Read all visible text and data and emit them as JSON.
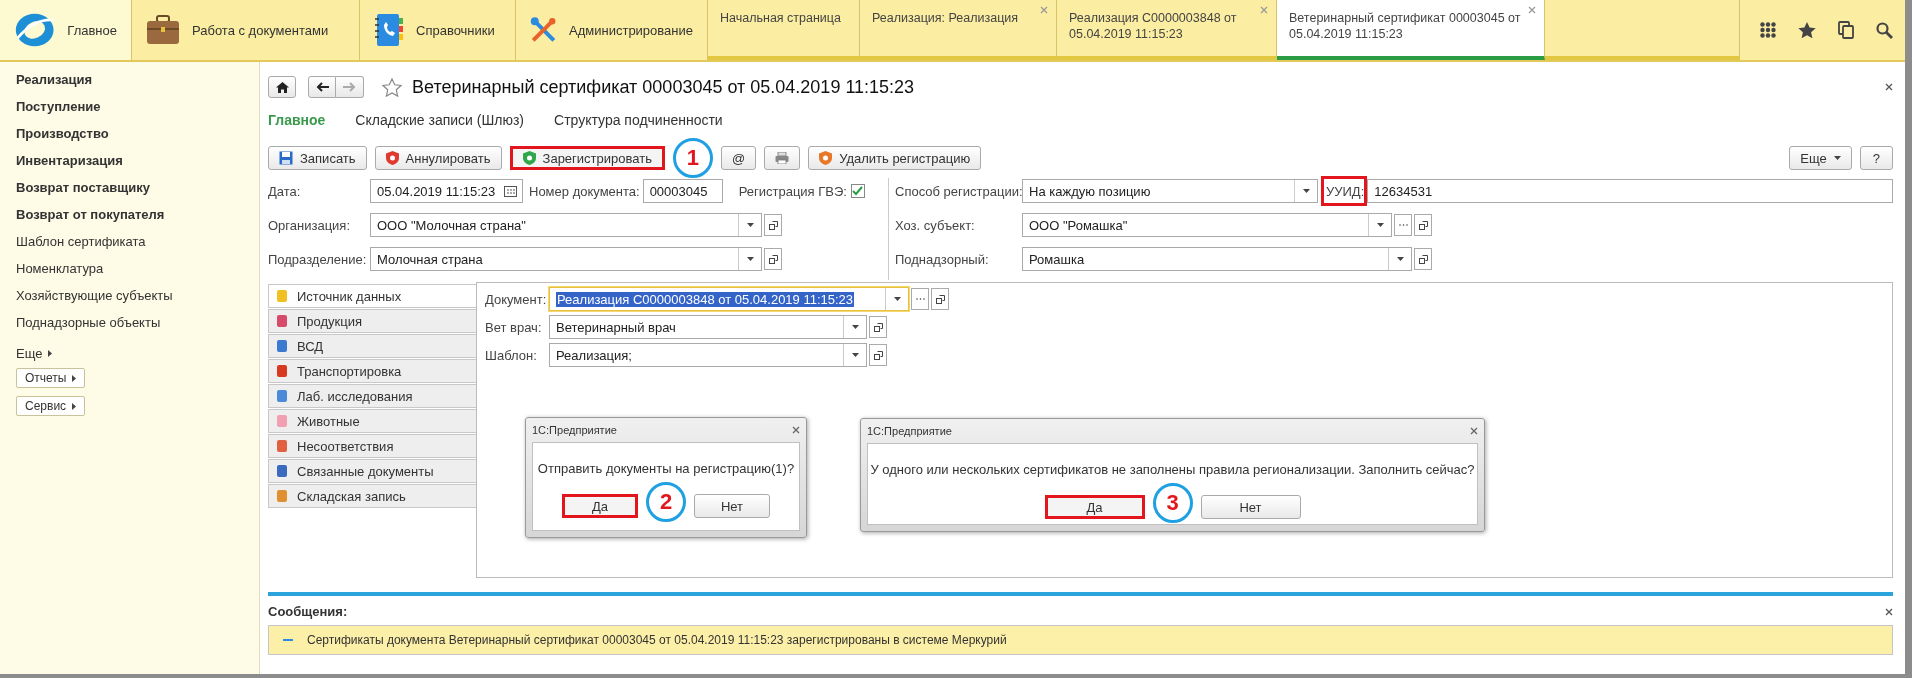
{
  "top_sections": [
    {
      "label": "Главное",
      "selected": true
    },
    {
      "label": "Работа с документами",
      "selected": false
    },
    {
      "label": "Справочники",
      "selected": false
    },
    {
      "label": "Администрирование",
      "selected": false
    }
  ],
  "open_tabs": [
    {
      "label": "Начальная страница",
      "selected": false,
      "closable": false
    },
    {
      "label": "Реализация: Реализация",
      "selected": false,
      "closable": true
    },
    {
      "label": "Реализация С0000003848 от 05.04.2019 11:15:23",
      "selected": false,
      "closable": true
    },
    {
      "label": "Ветеринарный сертификат 00003045 от 05.04.2019 11:15:23",
      "selected": true,
      "closable": true
    }
  ],
  "sidebar": {
    "items": [
      {
        "label": "Реализация",
        "bold": true
      },
      {
        "label": "Поступление",
        "bold": true
      },
      {
        "label": "Производство",
        "bold": true
      },
      {
        "label": "Инвентаризация",
        "bold": true
      },
      {
        "label": "Возврат поставщику",
        "bold": true
      },
      {
        "label": "Возврат от покупателя",
        "bold": true
      },
      {
        "label": "Шаблон сертификата",
        "bold": false
      },
      {
        "label": "Номенклатура",
        "bold": false
      },
      {
        "label": "Хозяйствующие субъекты",
        "bold": false
      },
      {
        "label": "Поднадзорные объекты",
        "bold": false
      }
    ],
    "more": "Еще",
    "buttons": [
      "Отчеты",
      "Сервис"
    ]
  },
  "form": {
    "title": "Ветеринарный сертификат 00003045 от 05.04.2019 11:15:23",
    "nav": [
      {
        "label": "Главное",
        "selected": true
      },
      {
        "label": "Складские записи (Шлюз)",
        "selected": false
      },
      {
        "label": "Структура подчиненности",
        "selected": false
      }
    ],
    "toolbar": [
      {
        "kind": "save",
        "label": "Записать",
        "highlighted": false
      },
      {
        "kind": "cancel",
        "label": "Аннулировать",
        "highlighted": false
      },
      {
        "kind": "register",
        "label": "Зарегистрировать",
        "highlighted": true
      },
      {
        "kind": "mail",
        "label": "@",
        "highlighted": false
      },
      {
        "kind": "print",
        "highlighted": false
      },
      {
        "kind": "unregister",
        "label": "Удалить регистрацию",
        "highlighted": false
      }
    ],
    "toolbar_right": [
      {
        "kind": "menu",
        "label": "Еще"
      },
      {
        "kind": "help",
        "label": "?"
      }
    ],
    "date": {
      "label": "Дата:",
      "value": "05.04.2019 11:15:23"
    },
    "number": {
      "label": "Номер документа:",
      "value": "00003045"
    },
    "vet_registration": {
      "label": "Регистрация ГВЭ:",
      "checked": true
    },
    "method": {
      "label": "Способ регистрации:",
      "value": "На каждую позицию"
    },
    "uuid": {
      "label": "УУИД:",
      "value": "12634531",
      "highlighted": true
    },
    "organization": {
      "label": "Организация:",
      "value": "ООО \"Молочная страна\""
    },
    "business_entity": {
      "label": "Хоз. субъект:",
      "value": "ООО \"Ромашка\""
    },
    "subdivision": {
      "label": "Подразделение:",
      "value": "Молочная страна"
    },
    "supervised": {
      "label": "Поднадзорный:",
      "value": "Ромашка"
    }
  },
  "side_tabs": [
    {
      "label": "Источник данных",
      "selected": true
    },
    {
      "label": "Продукция",
      "selected": false
    },
    {
      "label": "ВСД",
      "selected": false
    },
    {
      "label": "Транспортировка",
      "selected": false
    },
    {
      "label": "Лаб. исследования",
      "selected": false
    },
    {
      "label": "Животные",
      "selected": false
    },
    {
      "label": "Несоответствия",
      "selected": false
    },
    {
      "label": "Связанные документы",
      "selected": false
    },
    {
      "label": "Складская запись",
      "selected": false
    }
  ],
  "source": [
    {
      "label": "Документ:",
      "value": "Реализация С0000003848 от 05.04.2019 11:15:23",
      "focused": true
    },
    {
      "label": "Вет врач:",
      "value": "Ветеринарный врач",
      "focused": false
    },
    {
      "label": "Шаблон:",
      "value": "Реализация;",
      "focused": false
    }
  ],
  "dialogs": [
    {
      "title": "1С:Предприятие",
      "message": "Отправить документы на регистрацию(1)?",
      "buttons": [
        {
          "label": "Да",
          "highlighted": true
        },
        {
          "label": "Нет",
          "highlighted": false
        }
      ]
    },
    {
      "title": "1С:Предприятие",
      "message": "У одного или нескольких сертификатов не заполнены правила регионализации. Заполнить сейчас?",
      "buttons": [
        {
          "label": "Да",
          "highlighted": true
        },
        {
          "label": "Нет",
          "highlighted": false
        }
      ]
    }
  ],
  "annotations": [
    "1",
    "2",
    "3"
  ],
  "messages": {
    "title": "Сообщения:",
    "items": [
      "Сертификаты документа Ветеринарный сертификат 00003045 от 05.04.2019 11:15:23 зарегистрированы в системе Меркурий"
    ]
  }
}
